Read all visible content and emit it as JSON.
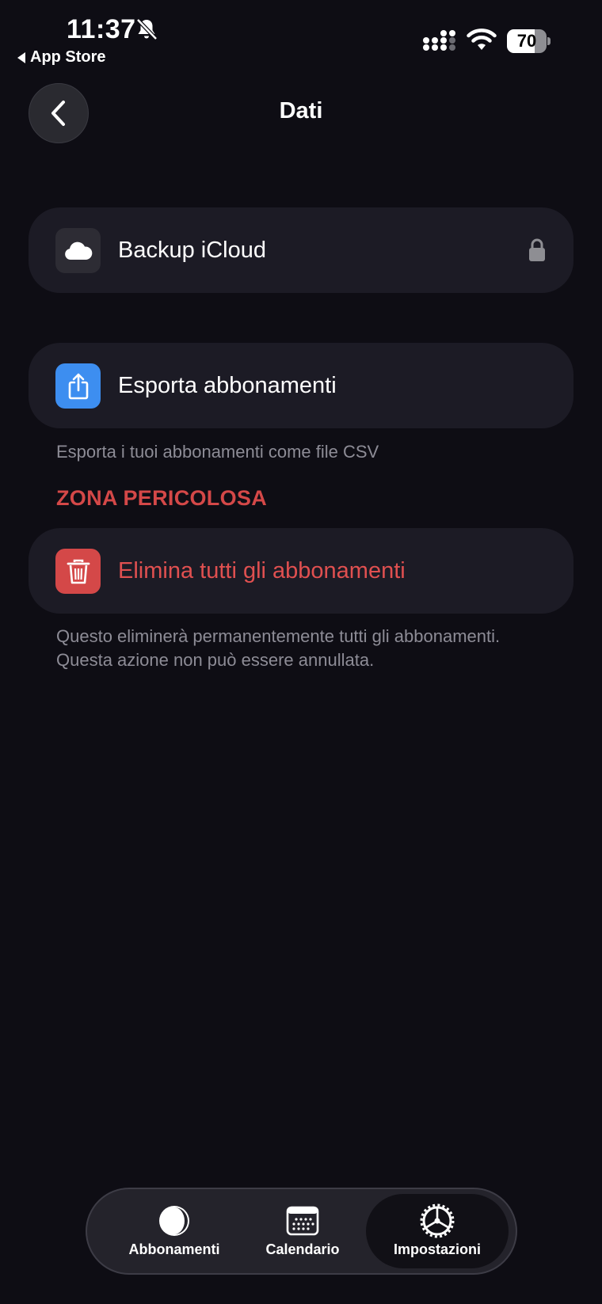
{
  "status_bar": {
    "time": "11:37",
    "back_app": "App Store",
    "battery_percent": "70",
    "battery_level": 0.7
  },
  "header": {
    "title": "Dati"
  },
  "rows": {
    "icloud": {
      "label": "Backup iCloud",
      "icon": "cloud-icon"
    },
    "export": {
      "label": "Esporta abbonamenti",
      "icon": "share-icon",
      "caption": "Esporta i tuoi abbonamenti come file CSV"
    },
    "danger_title": "ZONA PERICOLOSA",
    "delete": {
      "label": "Elimina tutti gli abbonamenti",
      "icon": "trash-icon",
      "caption_line1": "Questo eliminerà permanentemente tutti gli abbonamenti.",
      "caption_line2": "Questa azione non può essere annullata."
    }
  },
  "tabbar": {
    "tabs": [
      {
        "label": "Abbonamenti",
        "icon": "half-circle-icon"
      },
      {
        "label": "Calendario",
        "icon": "calendar-icon"
      },
      {
        "label": "Impostazioni",
        "icon": "gear-icon",
        "active": true
      }
    ]
  },
  "colors": {
    "background": "#0e0d14",
    "row": "#1c1b25",
    "danger": "#d44848",
    "accent_blue": "#3d8ef0"
  }
}
